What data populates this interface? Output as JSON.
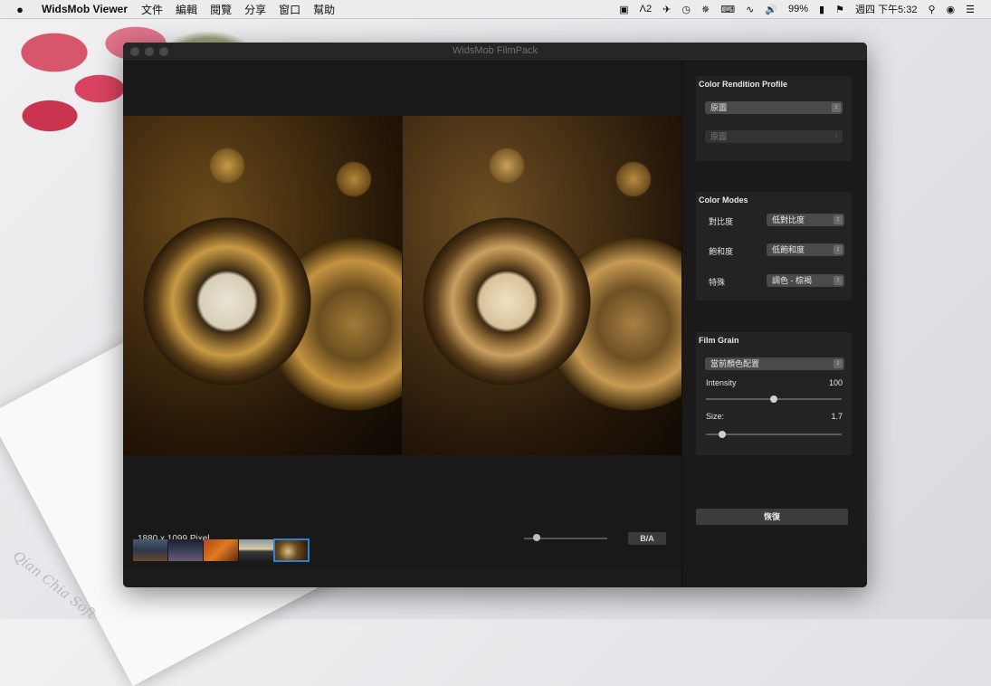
{
  "menubar": {
    "app_name": "WidsMob Viewer",
    "menus": [
      "文件",
      "編輯",
      "閱覽",
      "分享",
      "窗口",
      "幫助"
    ],
    "status_adobe": "2",
    "battery": "99%",
    "clock": "週四 下午5:32"
  },
  "window": {
    "title": "WidsMob FilmPack"
  },
  "preview": {
    "dimensions": "1880 x 1099 Pixel",
    "ba_label": "B/A",
    "zoom_level": 0.15
  },
  "profile_panel": {
    "title": "Color Rendition Profile",
    "primary_value": "原圖",
    "secondary_value": "原圖"
  },
  "modes_panel": {
    "title": "Color Modes",
    "rows": [
      {
        "label": "對比度",
        "value": "低對比度"
      },
      {
        "label": "飽和度",
        "value": "低飽和度"
      },
      {
        "label": "特殊",
        "value": "調色 - 棕褐"
      }
    ]
  },
  "grain_panel": {
    "title": "Film Grain",
    "preset_value": "當前顏色配置",
    "intensity_label": "Intensity",
    "intensity_value": "100",
    "intensity_fraction": 0.5,
    "size_label": "Size:",
    "size_value": "1.7",
    "size_fraction": 0.12
  },
  "reset_label": "恢復",
  "watermark": "Qian Chia Soft",
  "colors": {
    "window_bg": "#1c1c1c",
    "panel_bg": "#232323",
    "selection_accent": "#2f7fd6"
  }
}
